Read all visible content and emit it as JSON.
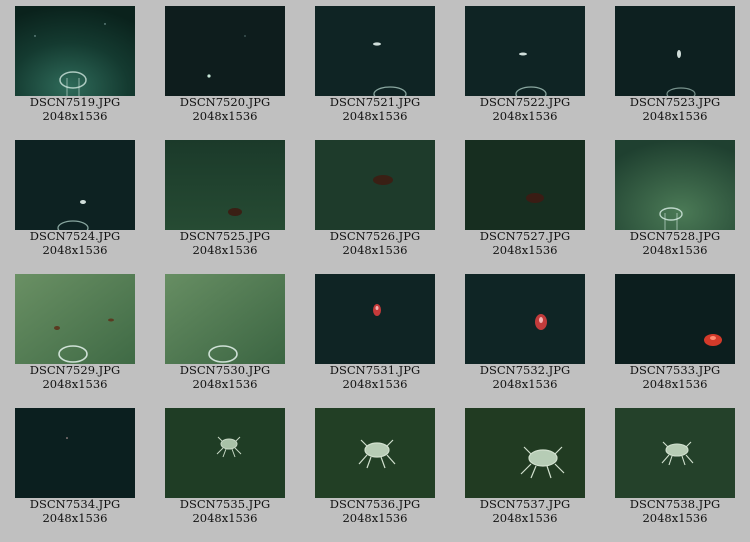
{
  "thumbnails": [
    {
      "filename": "DSCN7519.JPG",
      "dimensions": "2048x1536"
    },
    {
      "filename": "DSCN7520.JPG",
      "dimensions": "2048x1536"
    },
    {
      "filename": "DSCN7521.JPG",
      "dimensions": "2048x1536"
    },
    {
      "filename": "DSCN7522.JPG",
      "dimensions": "2048x1536"
    },
    {
      "filename": "DSCN7523.JPG",
      "dimensions": "2048x1536"
    },
    {
      "filename": "DSCN7524.JPG",
      "dimensions": "2048x1536"
    },
    {
      "filename": "DSCN7525.JPG",
      "dimensions": "2048x1536"
    },
    {
      "filename": "DSCN7526.JPG",
      "dimensions": "2048x1536"
    },
    {
      "filename": "DSCN7527.JPG",
      "dimensions": "2048x1536"
    },
    {
      "filename": "DSCN7528.JPG",
      "dimensions": "2048x1536"
    },
    {
      "filename": "DSCN7529.JPG",
      "dimensions": "2048x1536"
    },
    {
      "filename": "DSCN7530.JPG",
      "dimensions": "2048x1536"
    },
    {
      "filename": "DSCN7531.JPG",
      "dimensions": "2048x1536"
    },
    {
      "filename": "DSCN7532.JPG",
      "dimensions": "2048x1536"
    },
    {
      "filename": "DSCN7533.JPG",
      "dimensions": "2048x1536"
    },
    {
      "filename": "DSCN7534.JPG",
      "dimensions": "2048x1536"
    },
    {
      "filename": "DSCN7535.JPG",
      "dimensions": "2048x1536"
    },
    {
      "filename": "DSCN7536.JPG",
      "dimensions": "2048x1536"
    },
    {
      "filename": "DSCN7537.JPG",
      "dimensions": "2048x1536"
    },
    {
      "filename": "DSCN7538.JPG",
      "dimensions": "2048x1536"
    }
  ],
  "colors": {
    "page_background": "#c0c0c0",
    "caption_text": "#111111"
  }
}
